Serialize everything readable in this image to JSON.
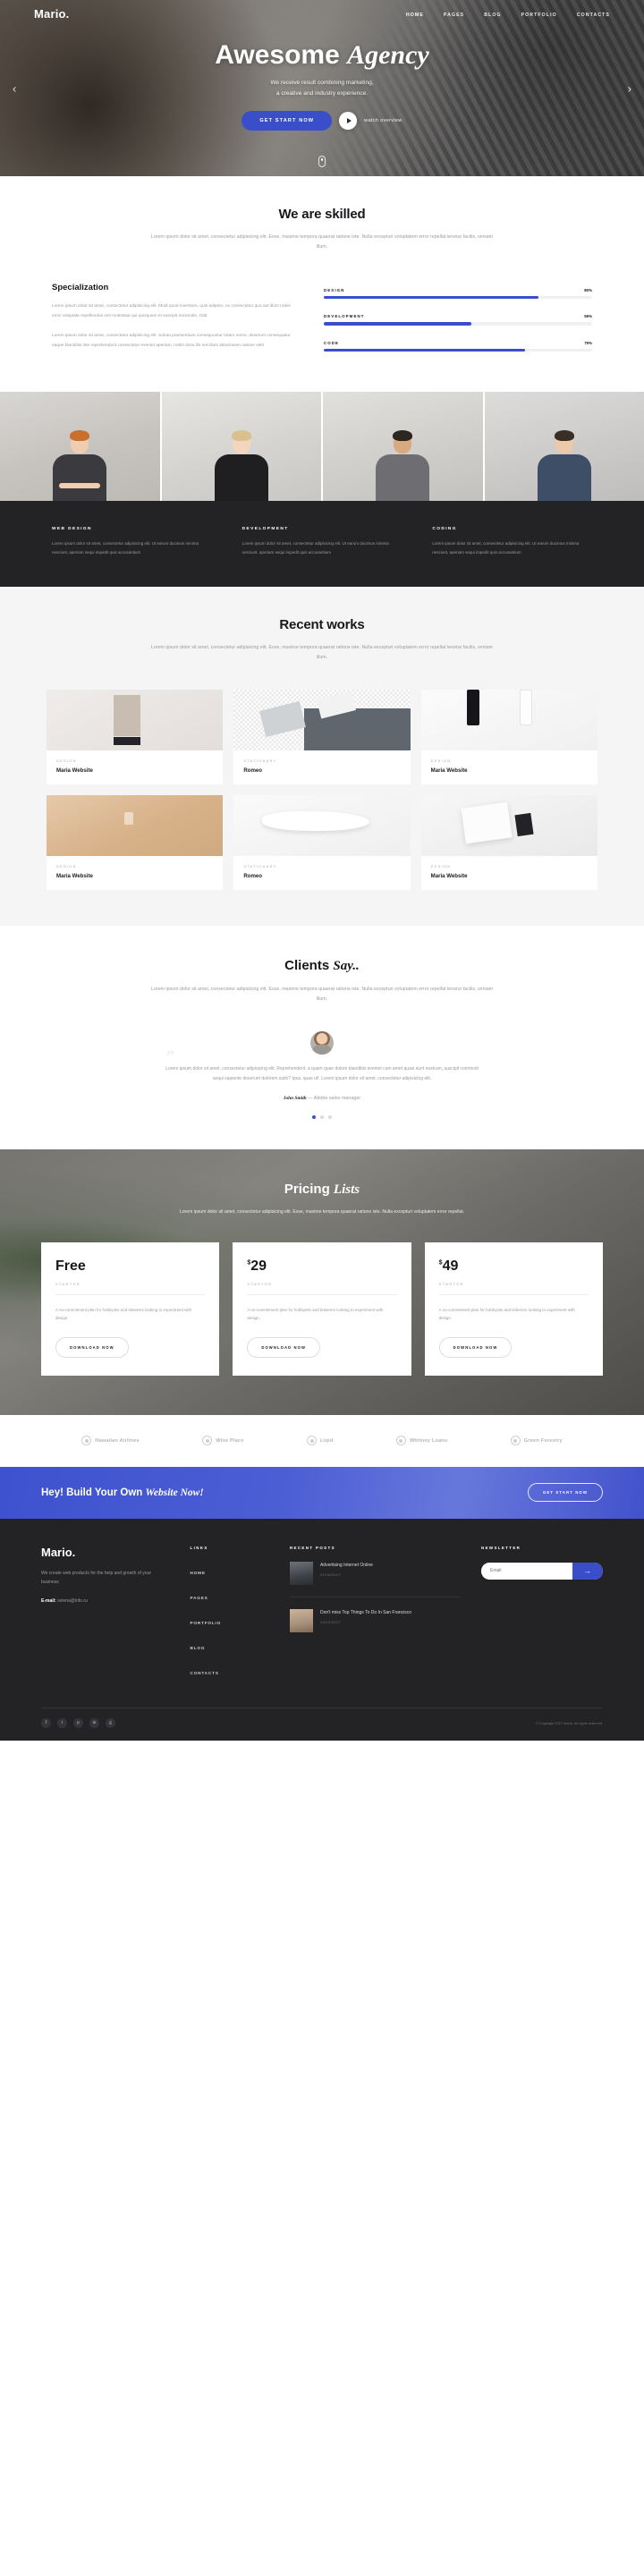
{
  "header": {
    "brand": "Mario.",
    "nav": [
      {
        "label": "HOME",
        "active": true
      },
      {
        "label": "PAGES",
        "active": false
      },
      {
        "label": "BLOG",
        "active": false
      },
      {
        "label": "PORTFOLIO",
        "active": false
      },
      {
        "label": "CONTACTS",
        "active": false
      }
    ]
  },
  "hero": {
    "title_plain": "Awesome",
    "title_italic": "Agency",
    "subtitle_line1": "We receive result combining marketing,",
    "subtitle_line2": "a creative and industry experience.",
    "cta_label": "GET START NOW",
    "watch_label": "watch overview",
    "prev_arrow": "‹",
    "next_arrow": "›"
  },
  "skilled": {
    "title": "We are skilled",
    "desc": "Lorem ipsum dolor sit amet, consectetur adipisicing elit. Esse, maxime tempora quaerat ratione iste. Nulla excepturi voluptatem error repellat tenetur facilis, veniam illum."
  },
  "specialization": {
    "title": "Specialization",
    "para1": "Lorem ipsum dolor sit amet, consectetur adipisicing elit. Modi quod inventore, quis adipisci, ex consectetur quo aut illum nobis error voluptate repellendus sint molestiae qui quisquam et suscipit reiciendis. Odit.",
    "para2": "Lorem ipsum dolor sit amet, consectetur adipisicing elit. Soluta praesentium consequuntur totam nemo, deserunt consequatur eaque blanditiis iste reprehenderit consectetur eveniet aperiam, nobis dicta illo nisi illum laboriosam ratione velit",
    "bars": [
      {
        "name": "DESIGN",
        "pct": 80,
        "pct_label": "80%"
      },
      {
        "name": "DEVELOPMENT",
        "pct": 55,
        "pct_label": "55%"
      },
      {
        "name": "CODE",
        "pct": 75,
        "pct_label": "75%"
      }
    ]
  },
  "team": [
    {
      "name": "team-member-1"
    },
    {
      "name": "team-member-2"
    },
    {
      "name": "team-member-3"
    },
    {
      "name": "team-member-4"
    }
  ],
  "services": [
    {
      "title": "WEB DESIGN",
      "text": "Lorem ipsum dolor sit amet, consectetur adipisicing elit. Ut earum ducimus minima nesciunt, aperiam sequi impedit quis accusantium"
    },
    {
      "title": "DEVELOPMENT",
      "text": "Lorem ipsum dolor sit amet, consectetur adipisicing elit. Ut earum ducimus minima nesciunt, aperiam sequi impedit quis accusantium"
    },
    {
      "title": "CODING",
      "text": "Lorem ipsum dolor sit amet, consectetur adipisicing elit. Ut earum ducimus minima nesciunt, aperiam sequi impedit quis accusantium"
    }
  ],
  "works": {
    "title": "Recent works",
    "desc": "Lorem ipsum dolor sit amet, consectetur adipisicing elit. Esse, maxime tempora quaerat ratione iste. Nulla excepturi voluptatem error repellat tenetur facilis, veniam illum.",
    "items": [
      {
        "category": "DESIGN",
        "title": "Maria Website"
      },
      {
        "category": "STATIONARY",
        "title": "Romeo"
      },
      {
        "category": "DESIGN",
        "title": "Maria Website"
      },
      {
        "category": "DESIGN",
        "title": "Maria Website"
      },
      {
        "category": "STATIONARY",
        "title": "Romeo"
      },
      {
        "category": "DESIGN",
        "title": "Maria Website"
      }
    ]
  },
  "clients": {
    "title_plain": "Clients",
    "title_italic": "Say..",
    "desc": "Lorem ipsum dolor sit amet, consectetur adipisicing elit. Esse, maxime tempora quaerat ratione iste. Nulla excepturi voluptatem error repellat tenetur facilis, veniam illum.",
    "quote_mark": "”",
    "quote": "Lorem ipsum dolor sit amet, consectetur adipisicing elit. Reprehenderit, a quam quae dolore blanditiis eveniet cum amet quasi sunt nostrum, suscipit commodi sequi sapiente deserunt dolorem iusto? Ipsa, quas ut!. Lorem ipsum dolor sit amet, consectetur adipisicing elit.",
    "author_name": "John Smith",
    "author_role": "— Adobe sales manager",
    "dots": [
      true,
      false,
      false
    ]
  },
  "pricing": {
    "title_plain": "Pricing",
    "title_italic": "Lists",
    "desc": "Lorem ipsum dolor sit amet, consectetur adipisicing elit. Esse, maxime tempora quaerat ratione iste. Nulla excepturi voluptatem error repellat.",
    "plans": [
      {
        "currency": "",
        "price": "Free",
        "label": "STARTER",
        "text": "A no-commitment plan for hobbyists and tinkerers looking to experiment with design.",
        "button": "DOWNLOAD NOW"
      },
      {
        "currency": "$",
        "price": "29",
        "label": "STARTER",
        "text": "A no-commitment plan for hobbyists and tinkerers looking to experiment with design.",
        "button": "DOWNLOAD NOW"
      },
      {
        "currency": "$",
        "price": "49",
        "label": "STARTER",
        "text": "A no-commitment plan for hobbyists and tinkerers looking to experiment with design.",
        "button": "DOWNLOAD NOW"
      }
    ]
  },
  "logos": [
    {
      "name": "Hawaiian Airlines"
    },
    {
      "name": "Wine Place"
    },
    {
      "name": "Liqid"
    },
    {
      "name": "Whitney Loans"
    },
    {
      "name": "Green Forestry"
    }
  ],
  "cta": {
    "title_plain": "Hey! Build Your Own",
    "title_italic": "Website Now!",
    "button": "GET START NOW"
  },
  "footer": {
    "brand": "Mario.",
    "about": "We create web products for the help and growth of your business",
    "email_label": "E-mail:",
    "email_value": "selena@info.ru",
    "links_title": "LINKS",
    "links": [
      {
        "label": "HOME"
      },
      {
        "label": "PAGES"
      },
      {
        "label": "PORTFOLIO"
      },
      {
        "label": "BLOG"
      },
      {
        "label": "CONTACTS"
      }
    ],
    "posts_title": "RECENT POSTS",
    "posts": [
      {
        "title": "Advertising Internet Online",
        "date": "01/06/2017"
      },
      {
        "title": "Don't miss Top Things To Do In San Francisco",
        "date": "14/02/2017"
      }
    ],
    "newsletter_title": "NEWSLETTER",
    "newsletter_placeholder": "Email",
    "newsletter_button": "→",
    "socials": [
      {
        "name": "facebook",
        "glyph": "f"
      },
      {
        "name": "twitter",
        "glyph": "t"
      },
      {
        "name": "pinterest",
        "glyph": "p"
      },
      {
        "name": "linkedin",
        "glyph": "in"
      },
      {
        "name": "google-plus",
        "glyph": "g"
      }
    ],
    "copyright": "© Copyright 2017 Mario. All rights reserved."
  }
}
